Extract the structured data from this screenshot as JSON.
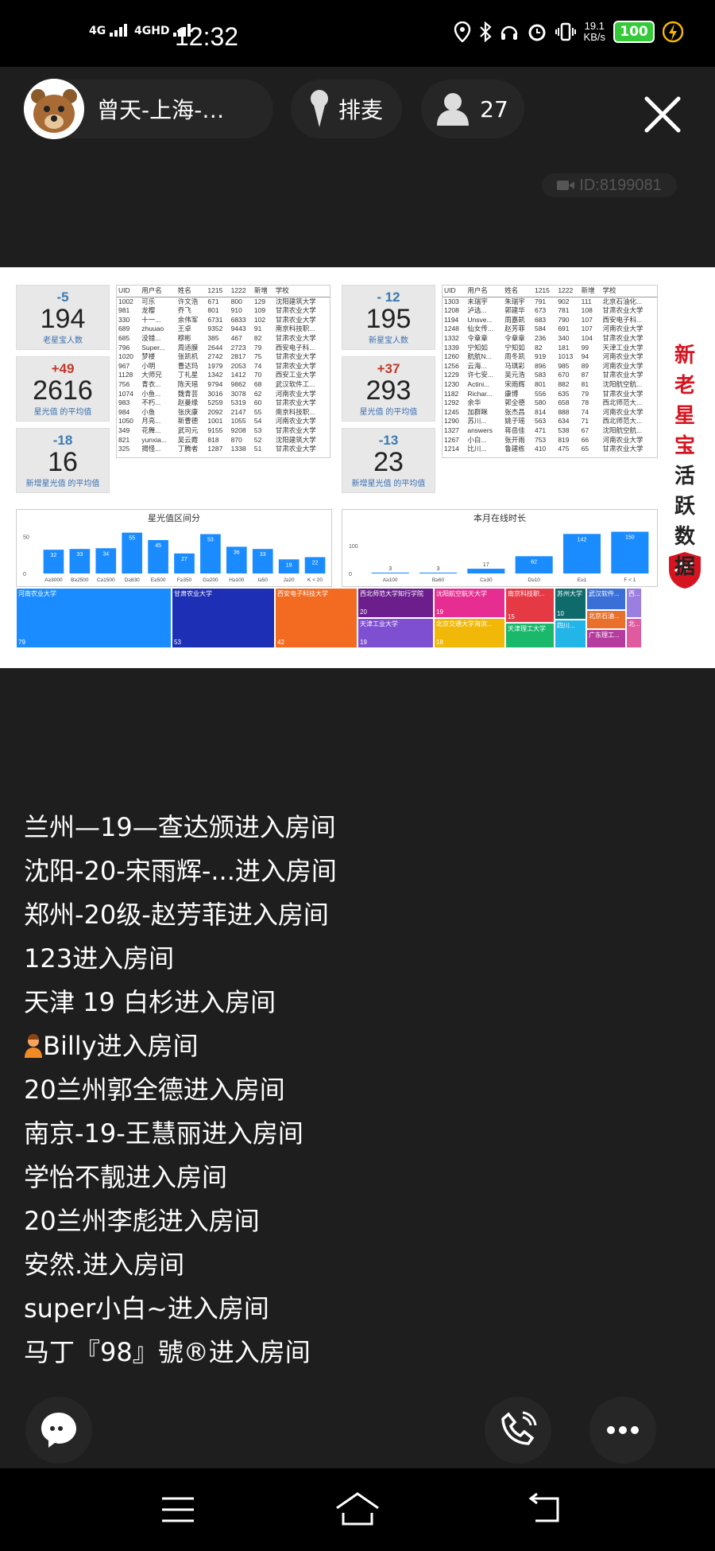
{
  "status_bar": {
    "network_1": "4G",
    "network_2": "4GHD",
    "time": "12:32",
    "speed_value": "19.1",
    "speed_unit": "KB/s",
    "battery": "100"
  },
  "header": {
    "host_name": "曾天-上海-…",
    "mic_label": "排麦",
    "viewer_count": "27",
    "room_id": "ID:8199081"
  },
  "slide": {
    "slogan": [
      "新",
      "老",
      "星",
      "宝",
      "活",
      "跃",
      "数",
      "据"
    ],
    "kpis": [
      {
        "delta": "-5",
        "value": "194",
        "label": "老星宝人数",
        "delta_color": "#3a7ab0"
      },
      {
        "delta": "+49",
        "value": "2616",
        "label": "星光值 的平均值",
        "delta_color": "#c0392b"
      },
      {
        "delta": "-18",
        "value": "16",
        "label": "新增星光值 的平均值",
        "delta_color": "#3a7ab0"
      },
      {
        "delta": "- 12",
        "value": "195",
        "label": "新星宝人数",
        "delta_color": "#3a7ab0"
      },
      {
        "delta": "+37",
        "value": "293",
        "label": "星光值 的平均值",
        "delta_color": "#c0392b"
      },
      {
        "delta": "-13",
        "value": "23",
        "label": "新增星光值 的平均值",
        "delta_color": "#3a7ab0"
      }
    ],
    "table_headers": [
      "UID",
      "用户名",
      "姓名",
      "1215",
      "1222",
      "新增",
      "学校"
    ],
    "table_left": [
      [
        "1002",
        "可乐",
        "许文浩",
        "671",
        "800",
        "129",
        "沈阳建筑大学"
      ],
      [
        "981",
        "龙樱",
        "乔飞",
        "801",
        "910",
        "109",
        "甘肃农业大学"
      ],
      [
        "330",
        "十一...",
        "余伟军",
        "6731",
        "6833",
        "102",
        "甘肃农业大学"
      ],
      [
        "689",
        "zhuuao",
        "王卓",
        "9352",
        "9443",
        "91",
        "南京科技职..."
      ],
      [
        "685",
        "没错...",
        "穆彬",
        "385",
        "467",
        "82",
        "甘肃农业大学"
      ],
      [
        "796",
        "Super...",
        "周适膜",
        "2644",
        "2723",
        "79",
        "西安电子科..."
      ],
      [
        "1020",
        "梦楼",
        "张凯机",
        "2742",
        "2817",
        "75",
        "甘肃农业大学"
      ],
      [
        "967",
        "小明",
        "曹达玛",
        "1979",
        "2053",
        "74",
        "甘肃农业大学"
      ],
      [
        "1128",
        "大师兄",
        "丁礼星",
        "1342",
        "1412",
        "70",
        "西安工业大学"
      ],
      [
        "756",
        "青衣...",
        "陈天瑶",
        "9794",
        "9862",
        "68",
        "武汉软件工..."
      ],
      [
        "1074",
        "小鱼...",
        "魏青芸",
        "3016",
        "3078",
        "62",
        "河南农业大学"
      ],
      [
        "983",
        "不朽...",
        "赵曼缘",
        "5259",
        "5319",
        "60",
        "甘肃农业大学"
      ],
      [
        "984",
        "小鱼",
        "张庆康",
        "2092",
        "2147",
        "55",
        "南京科技职..."
      ],
      [
        "1050",
        "月亮...",
        "新曹德",
        "1001",
        "1055",
        "54",
        "河南农业大学"
      ],
      [
        "349",
        "花舞...",
        "武司元",
        "9155",
        "9208",
        "53",
        "甘肃农业大学"
      ],
      [
        "821",
        "yunxia...",
        "吴云霞",
        "818",
        "870",
        "52",
        "沈阳建筑大学"
      ],
      [
        "325",
        "揭怪...",
        "丁腾者",
        "1287",
        "1338",
        "51",
        "甘肃农业大学"
      ]
    ],
    "table_right": [
      [
        "1303",
        "未瑞宇",
        "朱瑞宇",
        "791",
        "902",
        "111",
        "北京石油化..."
      ],
      [
        "1208",
        "泸选...",
        "郭建华",
        "673",
        "781",
        "108",
        "甘肃农业大学"
      ],
      [
        "1194",
        "Unsve...",
        "周嘉凯",
        "683",
        "790",
        "107",
        "西安电子科..."
      ],
      [
        "1248",
        "仙女传...",
        "赵芳菲",
        "584",
        "691",
        "107",
        "河南农业大学"
      ],
      [
        "1332",
        "令章章",
        "令章章",
        "236",
        "340",
        "104",
        "甘肃农业大学"
      ],
      [
        "1339",
        "宁知如",
        "宁知如",
        "82",
        "181",
        "99",
        "天津工业大学"
      ],
      [
        "1260",
        "航航N...",
        "周冬凯",
        "919",
        "1013",
        "94",
        "河南农业大学"
      ],
      [
        "1256",
        "云海...",
        "马琪彩",
        "896",
        "985",
        "89",
        "河南农业大学"
      ],
      [
        "1229",
        "许七安...",
        "吴元浩",
        "583",
        "670",
        "87",
        "甘肃农业大学"
      ],
      [
        "1230",
        "Actini...",
        "宋雨辉",
        "801",
        "882",
        "81",
        "沈阳航空航..."
      ],
      [
        "1182",
        "Richar...",
        "康博",
        "556",
        "635",
        "79",
        "甘肃农业大学"
      ],
      [
        "1292",
        "余华",
        "郭全德",
        "580",
        "658",
        "78",
        "西北师范大..."
      ],
      [
        "1245",
        "加群眯",
        "张杰昌",
        "814",
        "888",
        "74",
        "河南农业大学"
      ],
      [
        "1290",
        "苏川...",
        "姚子瑶",
        "563",
        "634",
        "71",
        "西北师范大..."
      ],
      [
        "1327",
        "answers",
        "蒋岳佳",
        "471",
        "538",
        "67",
        "沈阳航空航..."
      ],
      [
        "1267",
        "小白...",
        "张开雨",
        "753",
        "819",
        "66",
        "河南农业大学"
      ],
      [
        "1214",
        "比川...",
        "鲁建栋",
        "410",
        "475",
        "65",
        "甘肃农业大学"
      ]
    ],
    "chart_left": {
      "title": "星光值区间分",
      "type": "bar",
      "ylabel_ticks": [
        "50",
        "0"
      ],
      "categories": [
        "A≥3000",
        "B≥2500",
        "C≥1500",
        "D≥830",
        "E≥500",
        "F≥350",
        "G≥200",
        "H≥100",
        "I≥50",
        "J≥20",
        "K < 20"
      ],
      "values": [
        32,
        33,
        34,
        55,
        45,
        27,
        53,
        36,
        33,
        19,
        22
      ],
      "ymax": 60,
      "color": "#1a8cff"
    },
    "chart_right": {
      "title": "本月在线时长",
      "type": "bar",
      "ylabel_ticks": [
        "100",
        "0"
      ],
      "categories": [
        "A≥100",
        "B≥60",
        "C≥30",
        "D≥10",
        "E≥1",
        "F < 1"
      ],
      "values": [
        3,
        3,
        17,
        62,
        142,
        150
      ],
      "ymax": 160,
      "color": "#1a8cff"
    },
    "treemap": [
      {
        "label": "河南农业大学",
        "value": "79",
        "color": "#1a8cff"
      },
      {
        "label": "甘肃农业大学",
        "value": "53",
        "color": "#1c2fb5"
      },
      {
        "label": "西安电子科技大学",
        "value": "42",
        "color": "#f26b21"
      },
      {
        "label": "西北师范大学知行学院",
        "value": "20",
        "color": "#6b1e8c"
      },
      {
        "label": "天津工业大学",
        "value": "19",
        "color": "#7e4fd1"
      },
      {
        "label": "沈阳航空航天大学",
        "value": "19",
        "color": "#e62e92"
      },
      {
        "label": "北京交通大学海滨...",
        "value": "18",
        "color": "#f2b807"
      },
      {
        "label": "南京科技职...",
        "value": "15",
        "color": "#e63946"
      },
      {
        "label": "天津理工大学",
        "value": "",
        "color": "#19b86b"
      },
      {
        "label": "苏州大学",
        "value": "10",
        "color": "#0f6b6b"
      },
      {
        "label": "四川...",
        "value": "",
        "color": "#22b5e8"
      },
      {
        "label": "武汉软件...",
        "value": "",
        "color": "#3b6fd8"
      },
      {
        "label": "北京石油...",
        "value": "",
        "color": "#e8702a"
      },
      {
        "label": "广东理工...",
        "value": "",
        "color": "#b53b9e"
      },
      {
        "label": "西...",
        "value": "",
        "color": "#9b7fe0"
      },
      {
        "label": "北...",
        "value": "",
        "color": "#e05aa0"
      }
    ]
  },
  "chat": [
    "兰州—19—查达颁进入房间",
    "沈阳-20-宋雨辉-...进入房间",
    "郑州-20级-赵芳菲进入房间",
    "123进入房间",
    "天津 19 白杉进入房间",
    "Billy进入房间",
    "20兰州郭全德进入房间",
    "南京-19-王慧丽进入房间",
    "学怡不靓进入房间",
    "20兰州李彪进入房间",
    "安然.进入房间",
    "super小白~进入房间",
    "马丁『98』號®进入房间"
  ]
}
